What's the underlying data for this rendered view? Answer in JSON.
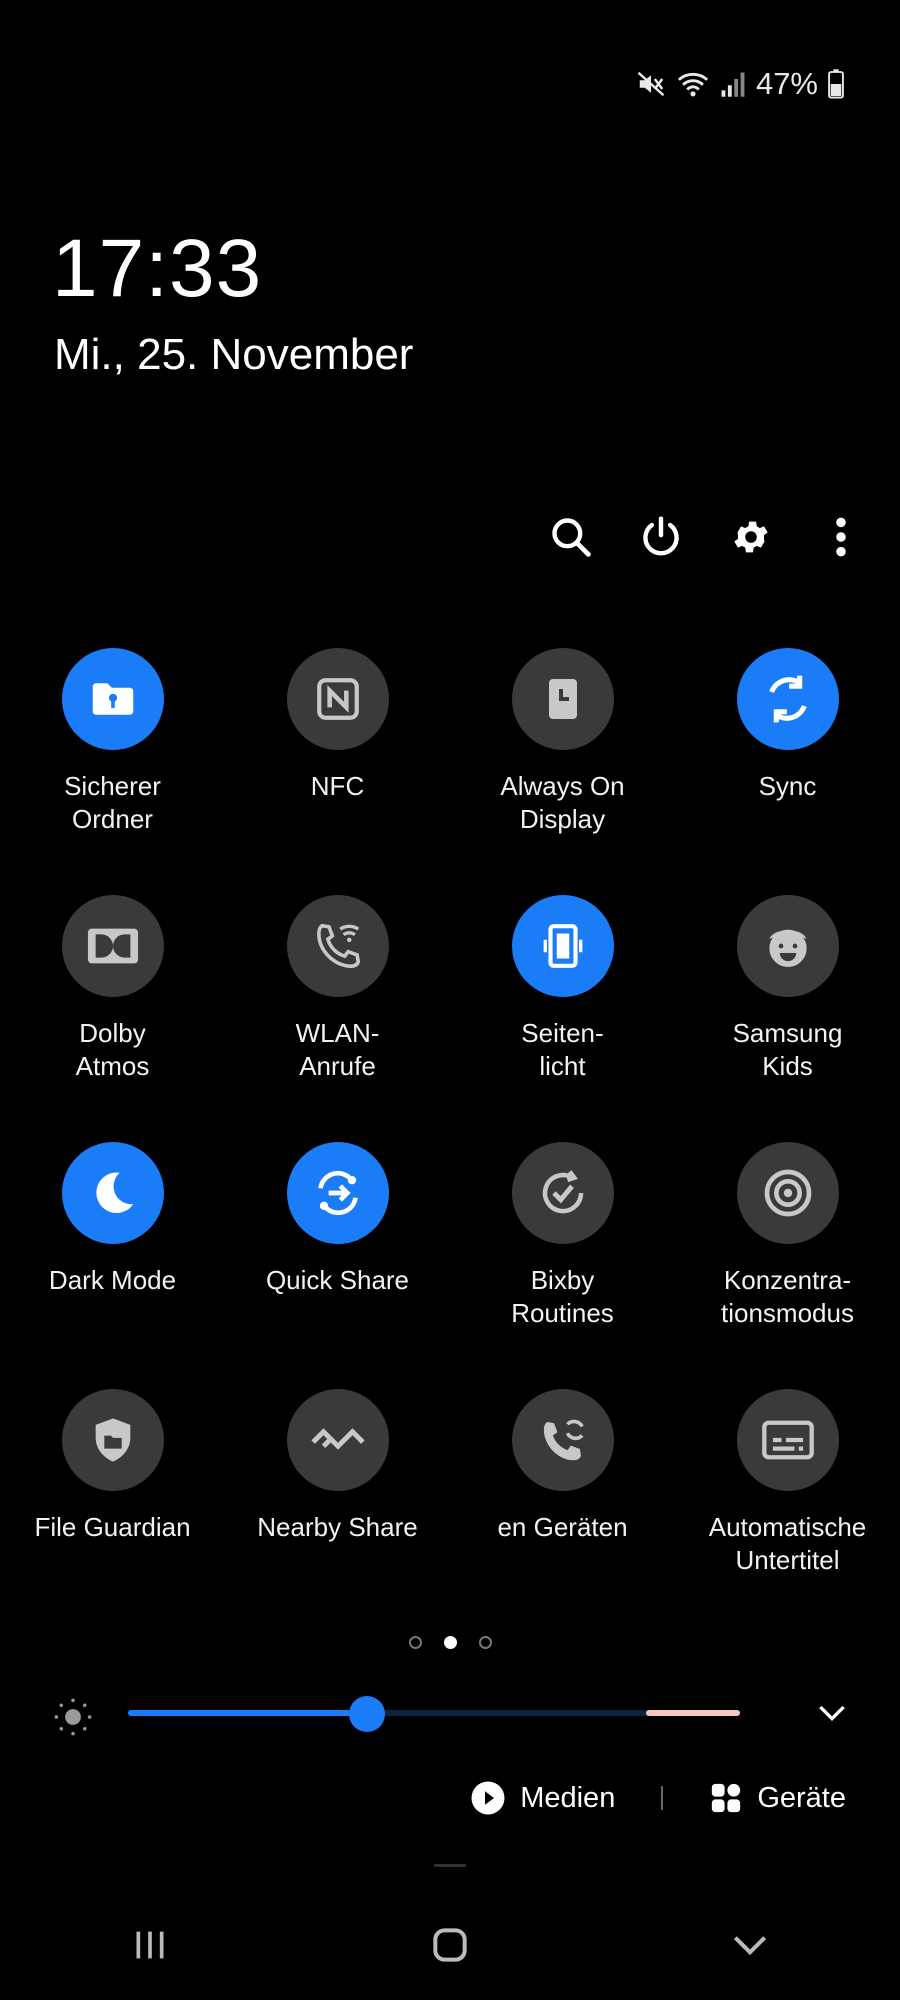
{
  "status": {
    "battery_text": "47%"
  },
  "lockscreen": {
    "time": "17:33",
    "date": "Mi., 25. November"
  },
  "quick_panel": {
    "tiles": [
      {
        "label": "Sicherer\nOrdner",
        "active": true
      },
      {
        "label": "NFC",
        "active": false
      },
      {
        "label": "Always On\nDisplay",
        "active": false
      },
      {
        "label": "Sync",
        "active": true
      },
      {
        "label": "Dolby\nAtmos",
        "active": false
      },
      {
        "label": "WLAN-\nAnrufe",
        "active": false
      },
      {
        "label": "Seiten-\nlicht",
        "active": true
      },
      {
        "label": "Samsung\nKids",
        "active": false
      },
      {
        "label": "Dark Mode",
        "active": true
      },
      {
        "label": "Quick Share",
        "active": true
      },
      {
        "label": "Bixby\nRoutines",
        "active": false
      },
      {
        "label": "Konzentra-\ntionsmodus",
        "active": false
      },
      {
        "label": "File Guardian",
        "active": false
      },
      {
        "label": "Nearby Share",
        "active": false
      },
      {
        "label": "en Geräten",
        "active": false
      },
      {
        "label": "Automatische\nUntertitel",
        "active": false
      }
    ],
    "page_indicator": {
      "count": 3,
      "current": 2
    },
    "brightness": {
      "level_percent": 39
    },
    "media_label": "Medien",
    "devices_label": "Geräte"
  },
  "colors": {
    "accent": "#1a7cf7",
    "tile_off": "#3a3a3a",
    "background": "#000000"
  }
}
